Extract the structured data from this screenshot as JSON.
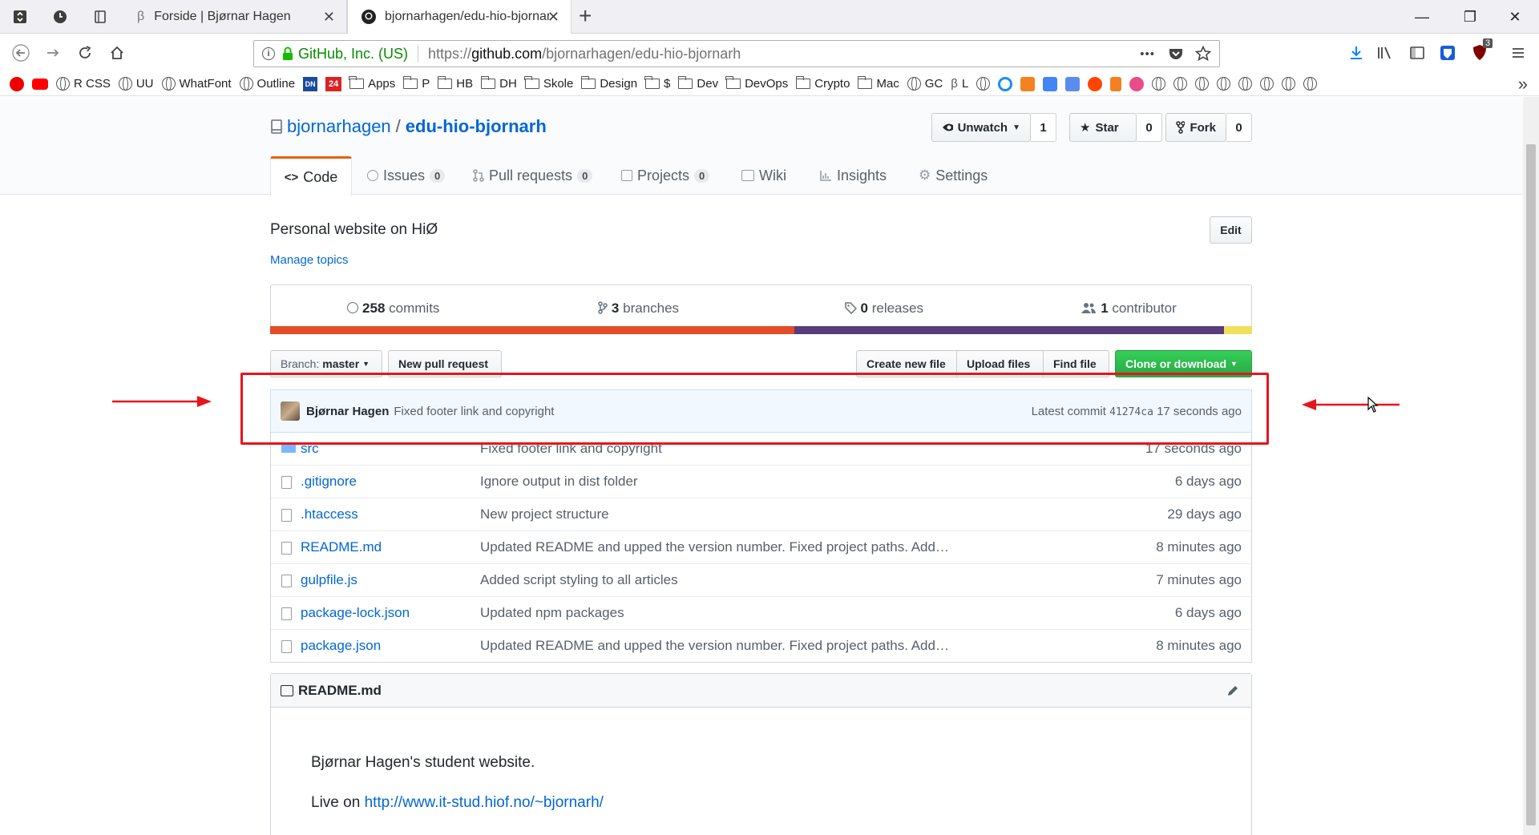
{
  "browser": {
    "tabs": [
      {
        "title": "Forside | Bjørnar Hagen"
      },
      {
        "title": "bjornarhagen/edu-hio-bjornarh"
      }
    ],
    "new_tab": "+",
    "url_identity": "GitHub, Inc. (US)",
    "url_prefix": "https://",
    "url_host": "github.com",
    "url_path": "/bjornarhagen/edu-hio-bjornarh",
    "page_actions": "•••",
    "ublock_count": "3",
    "bookmarks": [
      "R CSS",
      "UU",
      "WhatFont",
      "Outline",
      "DN",
      "24",
      "Apps",
      "P",
      "HB",
      "DH",
      "Skole",
      "Design",
      "$",
      "Dev",
      "DevOps",
      "Crypto",
      "Mac",
      "GC",
      "L"
    ],
    "bookmark_overflow": "»",
    "colors": {
      "firefox_blue": "#0a84ff",
      "secure_green": "#12bc00"
    }
  },
  "repo": {
    "owner": "bjornarhagen",
    "separator": "/",
    "name": "edu-hio-bjornarh",
    "actions": {
      "watch_label": "Unwatch",
      "watch_count": "1",
      "star_label": "Star",
      "star_count": "0",
      "fork_label": "Fork",
      "fork_count": "0"
    },
    "tabs": [
      {
        "label": "Code",
        "count": null
      },
      {
        "label": "Issues",
        "count": "0"
      },
      {
        "label": "Pull requests",
        "count": "0"
      },
      {
        "label": "Projects",
        "count": "0"
      },
      {
        "label": "Wiki",
        "count": null
      },
      {
        "label": "Insights",
        "count": null
      },
      {
        "label": "Settings",
        "count": null
      }
    ],
    "description": "Personal website on HiØ",
    "edit_label": "Edit",
    "manage_topics": "Manage topics",
    "summary": {
      "commits_count": "258",
      "commits_label": "commits",
      "branches_count": "3",
      "branches_label": "branches",
      "releases_count": "0",
      "releases_label": "releases",
      "contributors_count": "1",
      "contributors_label": "contributor"
    },
    "languages": [
      {
        "fraction": 0.5,
        "color": "#e34c26"
      },
      {
        "fraction": 0.41,
        "color": "#563d7c"
      },
      {
        "fraction": 0.027,
        "color": "#f1e05a"
      }
    ],
    "branch_prefix": "Branch:",
    "branch_name": "master",
    "new_pr": "New pull request",
    "create_file": "Create new file",
    "upload_files": "Upload files",
    "find_file": "Find file",
    "clone": "Clone or download",
    "latest_commit": {
      "author": "Bjørnar Hagen",
      "message": "Fixed footer link and copyright",
      "label": "Latest commit",
      "sha": "41274ca",
      "age": "17 seconds ago"
    },
    "files": [
      {
        "name": "src",
        "type": "dir",
        "message": "Fixed footer link and copyright",
        "age": "17 seconds ago"
      },
      {
        "name": ".gitignore",
        "type": "file",
        "message": "Ignore output in dist folder",
        "age": "6 days ago"
      },
      {
        "name": ".htaccess",
        "type": "file",
        "message": "New project structure",
        "age": "29 days ago"
      },
      {
        "name": "README.md",
        "type": "file",
        "message": "Updated README and upped the version number. Fixed project paths. Add…",
        "age": "8 minutes ago"
      },
      {
        "name": "gulpfile.js",
        "type": "file",
        "message": "Added script styling to all articles",
        "age": "7 minutes ago"
      },
      {
        "name": "package-lock.json",
        "type": "file",
        "message": "Updated npm packages",
        "age": "6 days ago"
      },
      {
        "name": "package.json",
        "type": "file",
        "message": "Updated README and upped the version number. Fixed project paths. Add…",
        "age": "8 minutes ago"
      }
    ],
    "readme": {
      "title": "README.md",
      "body_line": "Bjørnar Hagen's student website.",
      "live_prefix": "Live on",
      "live_link": "http://www.it-stud.hiof.no/~bjornarh/"
    }
  },
  "annotation": {
    "color": "#e8141b"
  }
}
